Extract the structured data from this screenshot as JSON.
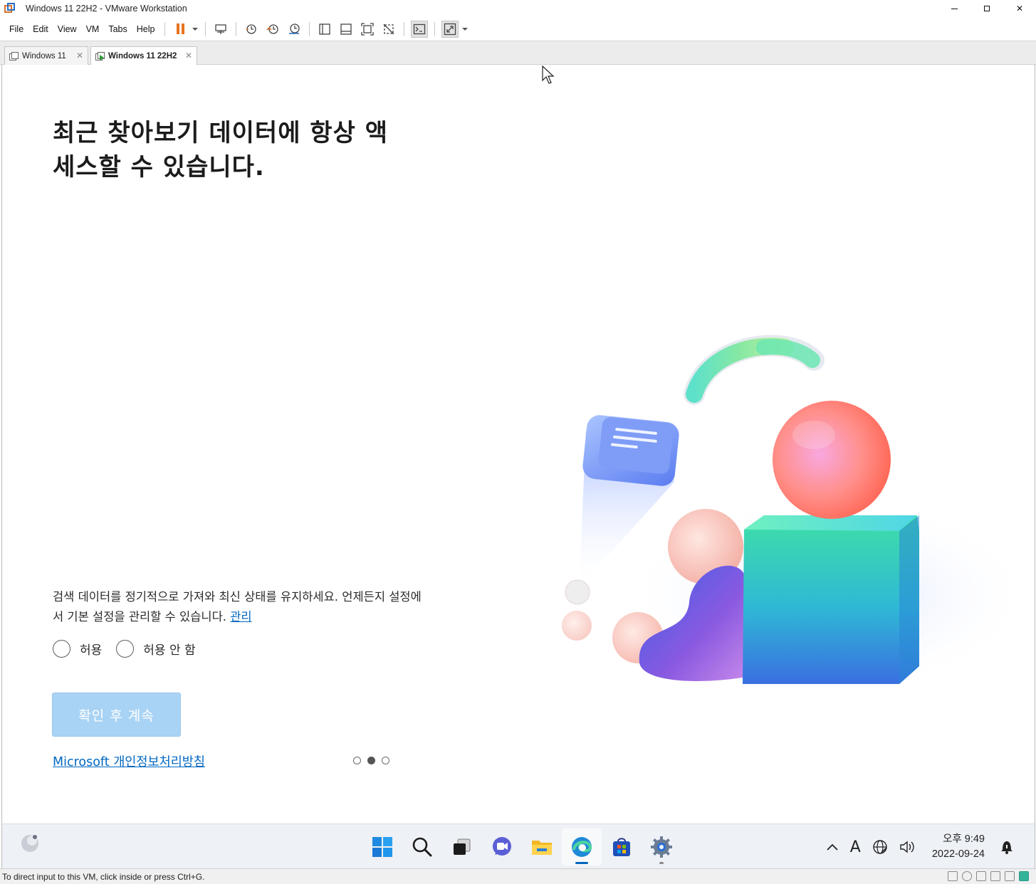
{
  "window": {
    "title": "Windows 11 22H2 - VMware Workstation",
    "min_glyph": "",
    "close_glyph": "✕"
  },
  "menu": [
    "File",
    "Edit",
    "View",
    "VM",
    "Tabs",
    "Help"
  ],
  "tabs": [
    {
      "label": "Windows 11",
      "active": false
    },
    {
      "label": "Windows 11 22H2",
      "active": true
    }
  ],
  "tab_close_glyph": "✕",
  "oobe": {
    "heading_line1": "최근 찾아보기 데이터에 항상 액",
    "heading_line2": "세스할 수 있습니다.",
    "description": "검색 데이터를 정기적으로 가져와 최신 상태를 유지하세요. 언제든지 설정에서 기본 설정을 관리할 수 있습니다.",
    "manage_link": "관리",
    "radio_allow": "허용",
    "radio_deny": "허용 안 함",
    "continue_button": "확인 후 계속",
    "privacy_link": "Microsoft 개인정보처리방침",
    "pager": {
      "pages": 3,
      "current": 2
    }
  },
  "taskbar": {
    "icons": [
      "windows-start-icon",
      "search-icon",
      "task-view-icon",
      "chat-icon",
      "file-explorer-icon",
      "edge-icon",
      "store-icon",
      "settings-icon"
    ],
    "clock_time": "오후 9:49",
    "clock_date": "2022-09-24",
    "ime_label": "A",
    "chevron": "^"
  },
  "status": {
    "text": "To direct input to this VM, click inside or press Ctrl+G."
  },
  "colors": {
    "accent": "#0067c0",
    "button_disabled": "#a9d3f4",
    "pause": "#e8731f"
  }
}
